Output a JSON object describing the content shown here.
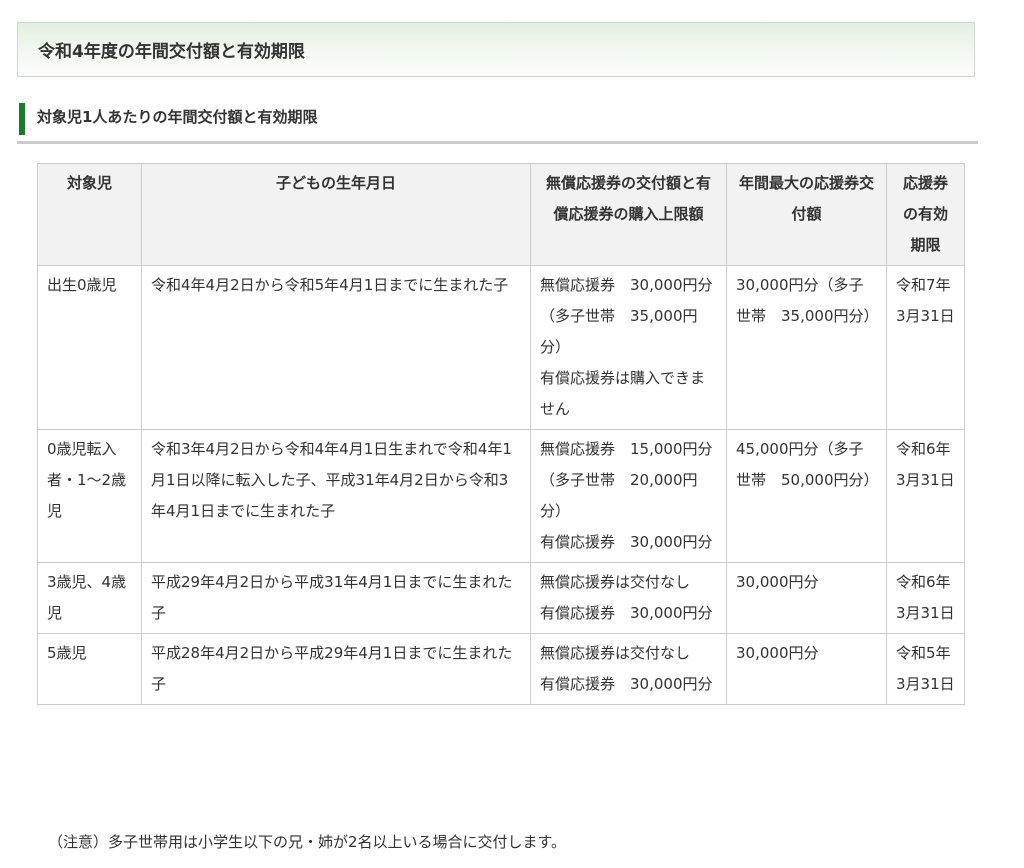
{
  "section": {
    "title": "令和4年度の年間交付額と有効期限"
  },
  "subsection": {
    "title": "対象児1人あたりの年間交付額と有効期限"
  },
  "table": {
    "headers": [
      "対象児",
      "子どもの生年月日",
      "無償応援券の交付額と有償応援券の購入上限額",
      "年間最大の応援券交付額",
      "応援券の有効期限"
    ],
    "rows": [
      [
        "出生0歳児",
        "令和4年4月2日から令和5年4月1日までに生まれた子",
        "無償応援券　30,000円分（多子世帯　35,000円分）\n有償応援券は購入できません",
        "30,000円分（多子世帯　35,000円分）",
        "令和7年3月31日"
      ],
      [
        "0歳児転入者・1〜2歳児",
        "令和3年4月2日から令和4年4月1日生まれで令和4年1月1日以降に転入した子、平成31年4月2日から令和3年4月1日までに生まれた子",
        "無償応援券　15,000円分（多子世帯　20,000円分）\n有償応援券　30,000円分",
        "45,000円分（多子世帯　50,000円分）",
        "令和6年3月31日"
      ],
      [
        "3歳児、4歳児",
        "平成29年4月2日から平成31年4月1日までに生まれた子",
        "無償応援券は交付なし\n有償応援券　30,000円分",
        "30,000円分",
        "令和6年3月31日"
      ],
      [
        "5歳児",
        "平成28年4月2日から平成29年4月1日までに生まれた子",
        "無償応援券は交付なし\n有償応援券　30,000円分",
        "30,000円分",
        "令和5年3月31日"
      ]
    ]
  },
  "note": "（注意）多子世帯用は小学生以下の兄・姉が2名以上いる場合に交付します。"
}
